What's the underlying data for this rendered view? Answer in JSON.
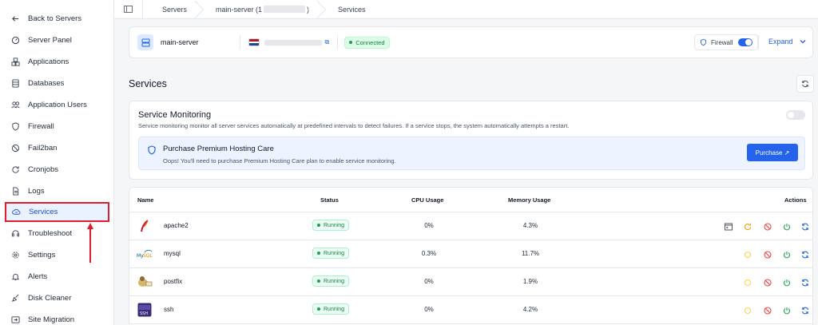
{
  "sidebar": {
    "items": [
      {
        "label": "Back to Servers",
        "icon": "arrow-left-icon"
      },
      {
        "label": "Server Panel",
        "icon": "gauge-icon"
      },
      {
        "label": "Applications",
        "icon": "cubes-icon"
      },
      {
        "label": "Databases",
        "icon": "database-icon"
      },
      {
        "label": "Application Users",
        "icon": "users-icon"
      },
      {
        "label": "Firewall",
        "icon": "shield-icon"
      },
      {
        "label": "Fail2ban",
        "icon": "ban-icon"
      },
      {
        "label": "Cronjobs",
        "icon": "refresh-icon"
      },
      {
        "label": "Logs",
        "icon": "file-icon"
      },
      {
        "label": "Services",
        "icon": "cloud-icon"
      },
      {
        "label": "Troubleshoot",
        "icon": "headset-icon"
      },
      {
        "label": "Settings",
        "icon": "gear-icon"
      },
      {
        "label": "Alerts",
        "icon": "bell-icon"
      },
      {
        "label": "Disk Cleaner",
        "icon": "broom-icon"
      },
      {
        "label": "Site Migration",
        "icon": "migration-icon"
      }
    ]
  },
  "breadcrumb": {
    "items": [
      "Servers",
      "main-server (1",
      ")",
      "Services"
    ]
  },
  "server": {
    "name": "main-server",
    "status": "Connected",
    "firewall_label": "Firewall",
    "expand_label": "Expand"
  },
  "services": {
    "title": "Services"
  },
  "monitoring": {
    "title": "Service Monitoring",
    "description": "Service monitoring monitor all server services automatically at predefined intervals to detect failures. If a service stops, the system automatically attempts a restart.",
    "promo_title": "Purchase Premium Hosting Care",
    "promo_desc": "Oops! You'll need to purchase Premium Hosting Care plan to enable service monitoring.",
    "purchase_label": "Purchase ↗"
  },
  "table": {
    "headers": {
      "name": "Name",
      "status": "Status",
      "cpu": "CPU Usage",
      "memory": "Memory Usage",
      "actions": "Actions"
    },
    "rows": [
      {
        "name": "apache2",
        "status": "Running",
        "cpu": "0%",
        "memory": "4.3%"
      },
      {
        "name": "mysql",
        "status": "Running",
        "cpu": "0.3%",
        "memory": "11.7%"
      },
      {
        "name": "postfix",
        "status": "Running",
        "cpu": "0%",
        "memory": "1.9%"
      },
      {
        "name": "ssh",
        "status": "Running",
        "cpu": "0%",
        "memory": "4.2%"
      }
    ]
  },
  "colors": {
    "accent": "#2563eb",
    "active_border": "#e11d2d",
    "running": "#15803d"
  }
}
